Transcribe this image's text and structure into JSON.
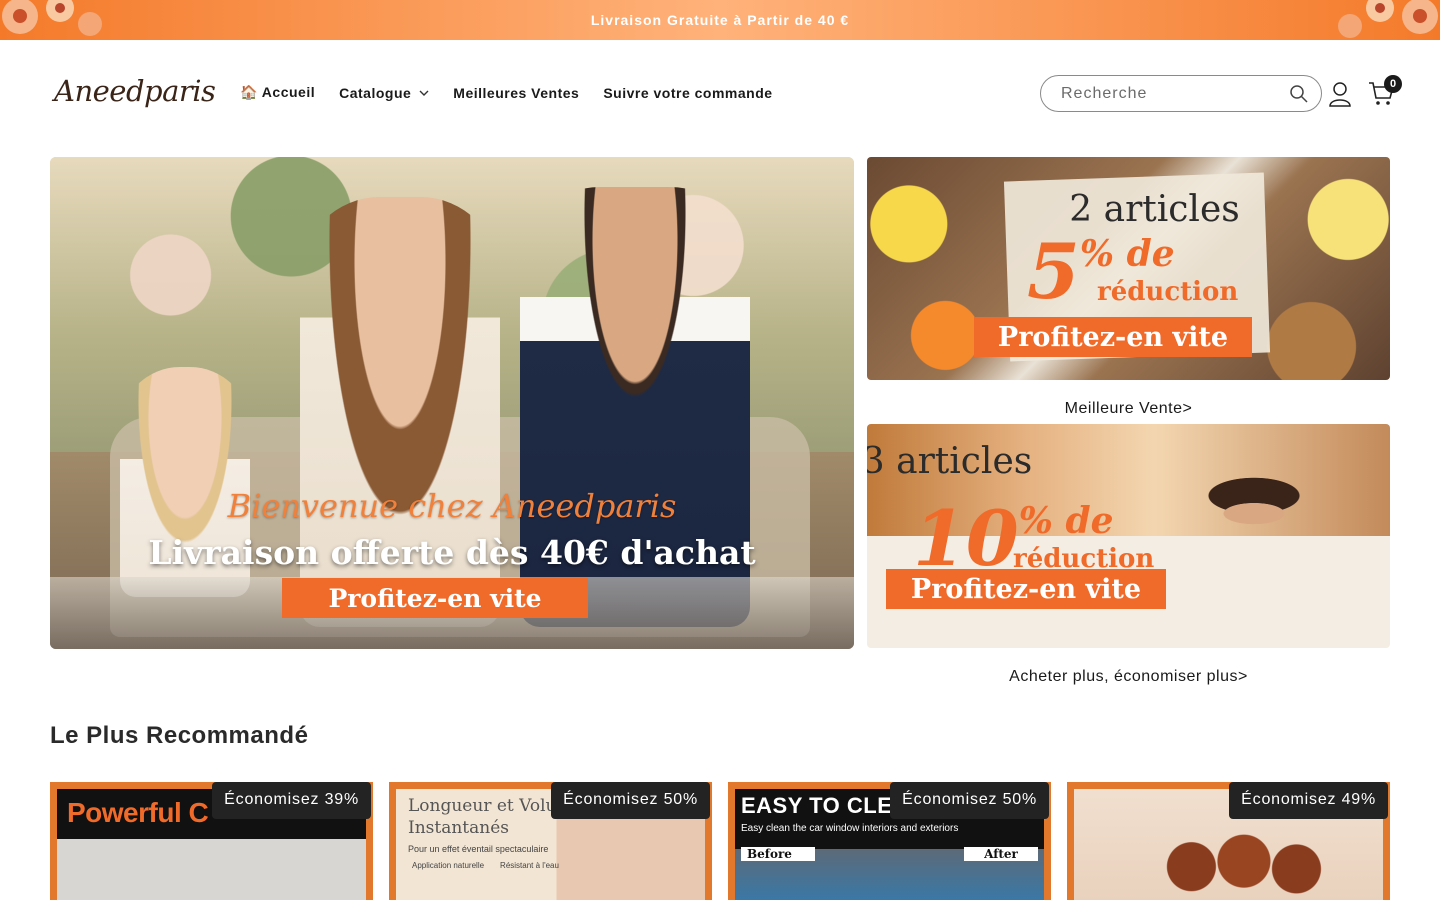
{
  "announcement": {
    "text": "Livraison Gratuite à Partir de 40 €"
  },
  "header": {
    "logo": "Aneedparis",
    "nav": [
      {
        "label": "🏠 Accueil"
      },
      {
        "label": "Catalogue"
      },
      {
        "label": "Meilleures Ventes"
      },
      {
        "label": "Suivre votre commande"
      }
    ],
    "search": {
      "placeholder": "Recherche",
      "value": ""
    },
    "cart_count": "0"
  },
  "hero": {
    "tagline": "Bienvenue chez Aneedparis",
    "headline": "Livraison offerte dès 40€ d'achat",
    "cta": "Profitez-en vite"
  },
  "promos": [
    {
      "title": "2 articles",
      "percent": "5",
      "percent_suffix": "% de",
      "subtitle": "réduction",
      "cta": "Profitez-en vite",
      "link": "Meilleure Vente>"
    },
    {
      "title": "3 articles",
      "percent": "10",
      "percent_suffix": "% de",
      "subtitle": "réduction",
      "cta": "Profitez-en vite",
      "link": "Acheter plus, économiser plus>"
    }
  ],
  "recommended": {
    "title": "Le Plus Recommandé",
    "products": [
      {
        "badge": "Économisez 39%",
        "image_text": "Powerful C"
      },
      {
        "badge": "Économisez 50%",
        "image_text": "Longueur et Volu Instantanés",
        "image_sub": "Pour un effet éventail spectaculaire",
        "icons": [
          "Application naturelle",
          "Résistant à l'eau"
        ]
      },
      {
        "badge": "Économisez 50%",
        "image_text": "EASY TO CLEA",
        "image_sub": "Easy clean the car window interiors and exteriors",
        "before": "Before",
        "after": "After"
      },
      {
        "badge": "Économisez 49%"
      }
    ]
  },
  "colors": {
    "accent": "#f06a2a",
    "badge_bg": "#232323",
    "card_border": "#e2782c"
  }
}
